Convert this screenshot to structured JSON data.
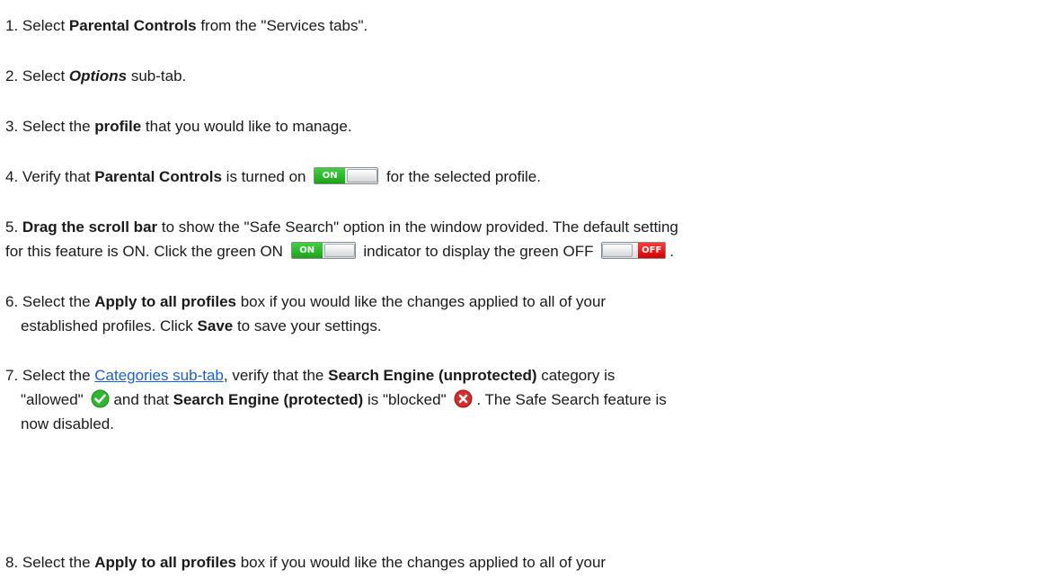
{
  "steps": [
    {
      "num": "1.",
      "a": "Select ",
      "b": "Parental Controls",
      "c": " from the \"Services tabs\"."
    },
    {
      "num": "2.",
      "a": "Select ",
      "b": "Options",
      "c": " sub-tab."
    },
    {
      "num": "3.",
      "a": "Select the ",
      "b": "profile",
      "c": " that you would like to manage."
    },
    {
      "num": "4.",
      "a": "Verify that ",
      "b": "Parental Controls",
      "c": " is turned on ",
      "d": " for the selected profile."
    },
    {
      "num": "5.",
      "b": "Drag the scroll bar",
      "c": " to show the \"Safe Search\" option in the window provided. The default setting",
      "line2a": "for this feature is ON. Click the green ON ",
      "line2b": " indicator  to display the green OFF ",
      "line2c": "."
    },
    {
      "num": "6.",
      "a": "Select the ",
      "b": "Apply to all profiles",
      "c": " box if you would like the changes applied to all of your",
      "line2a": "established profiles. Click ",
      "line2b": "Save",
      "line2c": " to save your settings."
    },
    {
      "num": "7.",
      "a": "Select the ",
      "link": "Categories sub-tab",
      "c": ", verify that the ",
      "d": "Search Engine (unprotected)",
      "e": " category is",
      "line2a": "\"allowed\" ",
      "line2b": "and that ",
      "line2c": "Search Engine (protected)",
      "line2d": " is \"blocked\" ",
      "line2e": ". The Safe Search feature is",
      "line3": "now disabled."
    },
    {
      "num": "8.",
      "a": "Select the ",
      "b": "Apply to all profiles",
      "c": " box if you would like the changes applied to all of your"
    }
  ],
  "toggles": {
    "on": "ON",
    "off": "OFF"
  },
  "icons": {
    "allowed": "check-circle-icon",
    "blocked": "x-circle-icon"
  },
  "colors": {
    "link": "#1a5fd6",
    "on_green": "#1aa31a",
    "off_red": "#d40000"
  }
}
